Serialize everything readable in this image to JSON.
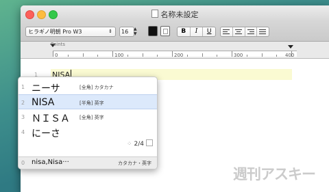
{
  "window": {
    "title": "名称未設定"
  },
  "toolbar": {
    "font_name": "ヒラギノ明朝 Pro W3",
    "font_size": "16",
    "style_buttons": [
      "B",
      "I",
      "U"
    ]
  },
  "ruler": {
    "label": "Points",
    "ticks": [
      "0",
      "100",
      "200",
      "300",
      "400"
    ]
  },
  "editor": {
    "line_number": "1",
    "typed_text": "NISA"
  },
  "candidates": {
    "items": [
      {
        "num": "1",
        "text": "ニーサ",
        "note": "[全角] カタカナ",
        "selected": false
      },
      {
        "num": "2",
        "text": "NISA",
        "note": "[半角] 英字",
        "selected": true
      },
      {
        "num": "3",
        "text": "ＮＩＳＡ",
        "note": "[全角] 英字",
        "selected": false
      },
      {
        "num": "4",
        "text": "にーさ",
        "note": "",
        "selected": false
      }
    ],
    "pager_text": "2/4",
    "footer": {
      "num": "0",
      "text": "nisa,Nisa···",
      "note": "カタカナ・英字"
    }
  },
  "watermark": "週刊アスキー"
}
